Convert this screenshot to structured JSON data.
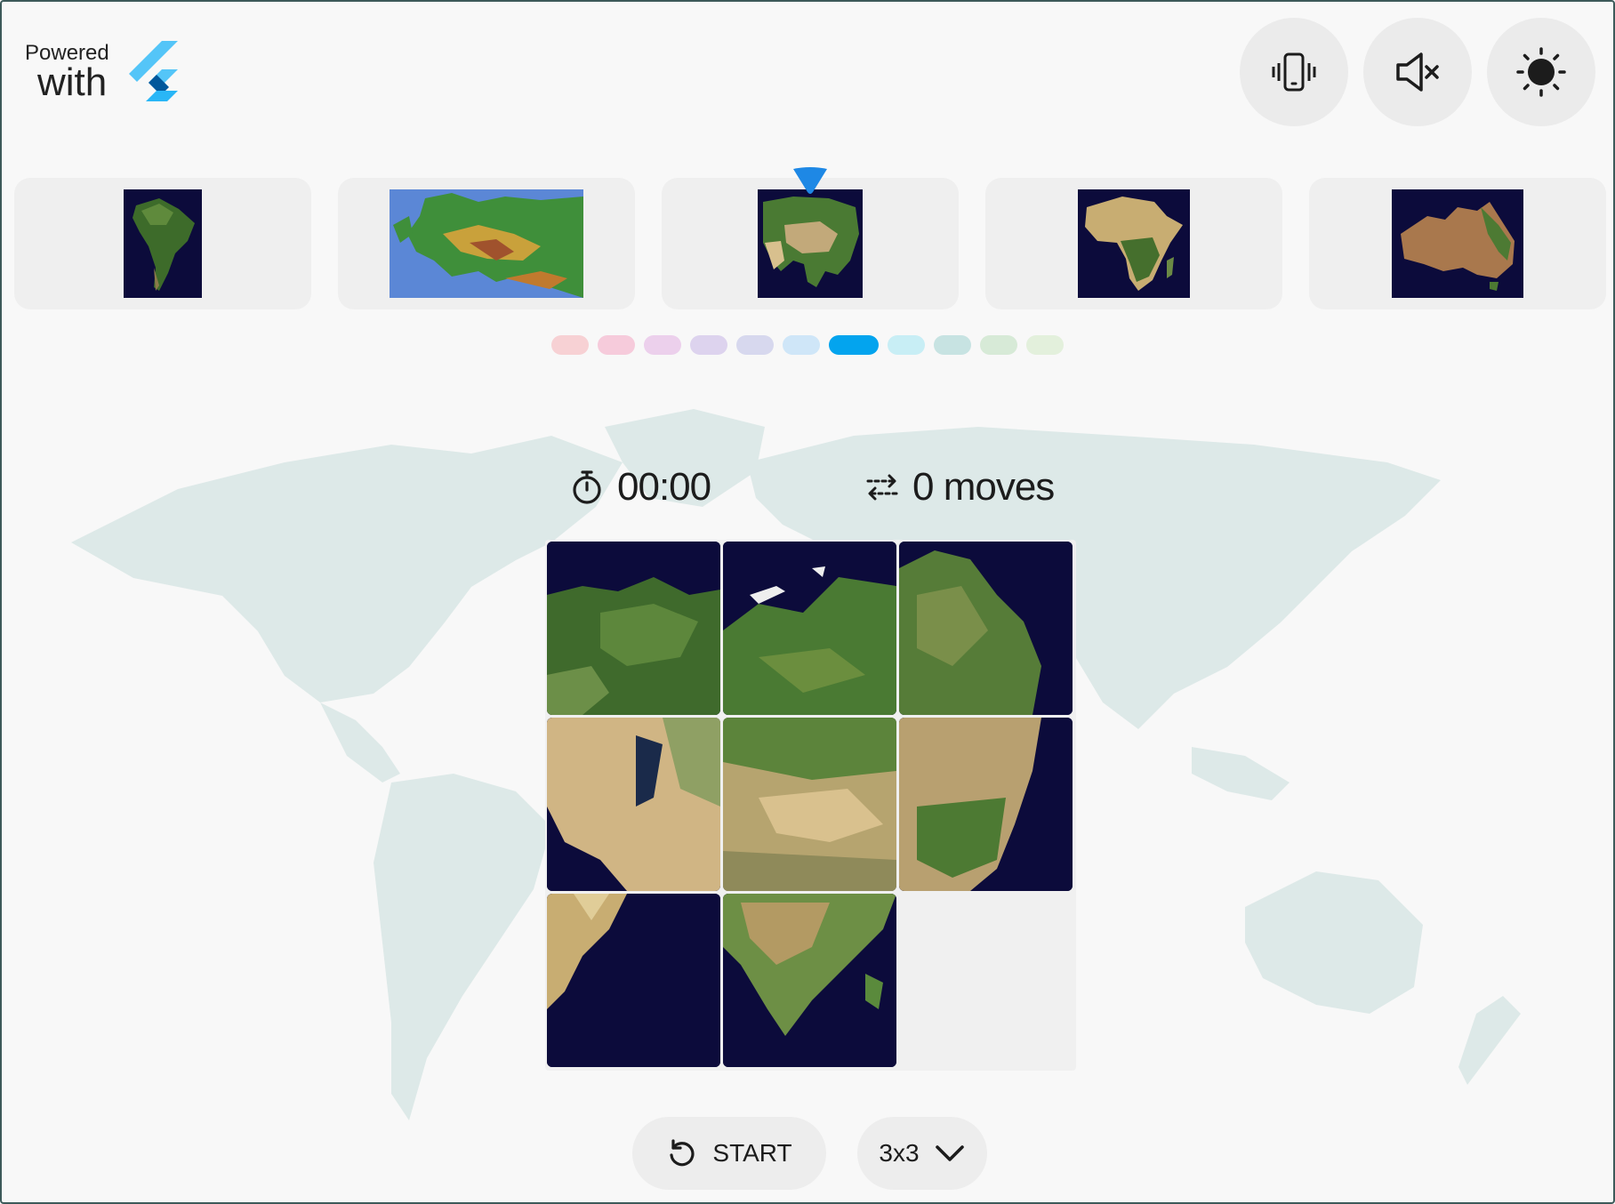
{
  "header": {
    "powered_label": "Powered",
    "with_label": "with",
    "logo_icon": "flutter-logo",
    "buttons": [
      {
        "name": "vibration-button",
        "icon": "vibration-icon"
      },
      {
        "name": "sound-toggle-button",
        "icon": "volume-off-icon"
      },
      {
        "name": "theme-toggle-button",
        "icon": "sun-icon"
      }
    ]
  },
  "carousel": {
    "items": [
      {
        "name": "South America",
        "selected": false
      },
      {
        "name": "Europe",
        "selected": false
      },
      {
        "name": "Asia",
        "selected": true
      },
      {
        "name": "Africa",
        "selected": false
      },
      {
        "name": "Australia",
        "selected": false
      }
    ],
    "pointer_color": "#1e88e5"
  },
  "levels": {
    "colors": [
      "#f7d1d4",
      "#f6cbdb",
      "#ecd0ec",
      "#ddd3ee",
      "#d7d8ee",
      "#cfe6f8",
      "#03a4ee",
      "#c8eef5",
      "#c7e3e2",
      "#d7ead7",
      "#e3f0dc"
    ],
    "active_index": 6
  },
  "stats": {
    "timer": "00:00",
    "moves": "0 moves",
    "timer_icon": "timer-icon",
    "moves_icon": "swap-arrows-icon"
  },
  "puzzle": {
    "size": 3,
    "tile_order": [
      1,
      2,
      3,
      4,
      5,
      6,
      7,
      8,
      null
    ],
    "empty_color": "#f0f0f0"
  },
  "footer": {
    "start_label": "START",
    "start_icon": "restart-icon",
    "grid_size_label": "3x3",
    "grid_icon": "chevron-down-icon"
  },
  "colors": {
    "background": "#f8f8f8",
    "ocean": "#0c0b3b",
    "accent": "#03a4ee",
    "map_silhouette": "#dde9e8"
  }
}
